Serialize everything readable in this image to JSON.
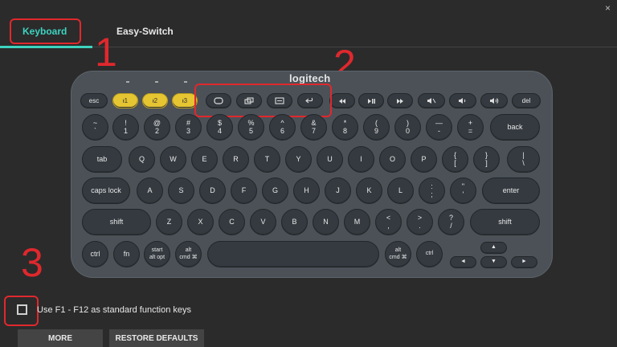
{
  "tabs": [
    {
      "label": "Keyboard",
      "active": true
    },
    {
      "label": "Easy-Switch",
      "active": false
    }
  ],
  "close_glyph": "×",
  "brand": "logitech",
  "annotations": [
    "1",
    "2",
    "3"
  ],
  "colors": {
    "accent": "#3cd4c0",
    "highlight": "#e0282d",
    "fn_key": "#e6c532"
  },
  "keyboard": {
    "top_row": {
      "esc": "esc",
      "easy_1": "ᵻ1",
      "easy_2": "ᵻ2",
      "easy_3": "ᵻ3",
      "app_switch_icon": "app-switch-icon",
      "window_icon": "windows-stack-icon",
      "menu_icon": "menu-icon",
      "back_icon": "back-icon",
      "prev_icon": "previous-track-icon",
      "play_icon": "play-pause-icon",
      "next_icon": "next-track-icon",
      "mute_icon": "mute-icon",
      "vol_down_icon": "volume-down-icon",
      "vol_up_icon": "volume-up-icon",
      "del": "del"
    },
    "num_row": [
      "~\n`",
      "!\n1",
      "@\n2",
      "#\n3",
      "$\n4",
      "%\n5",
      "^\n6",
      "&\n7",
      "*\n8",
      "(\n9",
      ")\n0",
      "—\n-",
      "+\n="
    ],
    "back": "back",
    "qwerty": [
      "Q",
      "W",
      "E",
      "R",
      "T",
      "Y",
      "U",
      "I",
      "O",
      "P",
      "{\n[",
      "}\n]",
      "|\n\\"
    ],
    "tab": "tab",
    "home": [
      "A",
      "S",
      "D",
      "F",
      "G",
      "H",
      "J",
      "K",
      "L",
      ":\n;",
      "\"\n'"
    ],
    "caps": "caps lock",
    "enter": "enter",
    "bottom_letters": [
      "Z",
      "X",
      "C",
      "V",
      "B",
      "N",
      "M",
      "<\n,",
      ">\n.",
      "?\n/"
    ],
    "shift": "shift",
    "ctrl": "ctrl",
    "fn": "fn",
    "start": "start\nalt opt",
    "alt": "alt\ncmd ⌘",
    "alt_right": "alt\ncmd ⌘",
    "ctrl_right": "ctrl",
    "arrows": {
      "up": "▲",
      "left": "◄",
      "down": "▼",
      "right": "►"
    }
  },
  "checkbox_label": "Use F1 - F12 as standard function keys",
  "buttons": {
    "more": "MORE",
    "restore": "RESTORE DEFAULTS"
  }
}
